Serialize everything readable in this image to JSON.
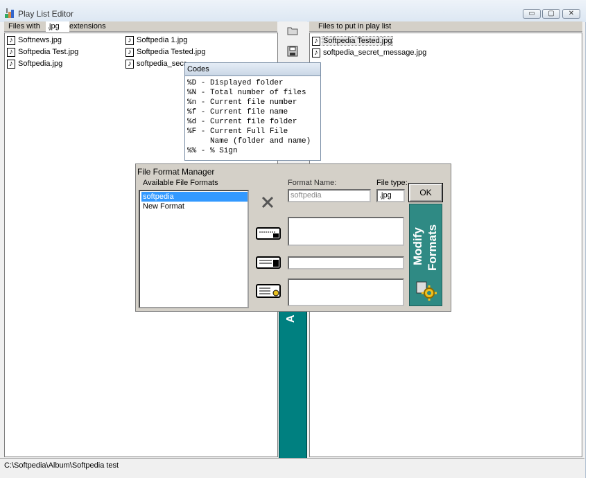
{
  "window": {
    "title": "Play List Editor",
    "minimize_label": "▭",
    "maximize_label": "▢",
    "close_label": "✕"
  },
  "left_header": {
    "prefix": "Files with",
    "extension": ".jpg",
    "suffix": "extensions"
  },
  "right_header": {
    "label": "Files to put in play list"
  },
  "left_files": [
    {
      "name": "Softnews.jpg"
    },
    {
      "name": "Softpedia Test.jpg"
    },
    {
      "name": "Softpedia.jpg"
    },
    {
      "name": "Softpedia 1.jpg"
    },
    {
      "name": "Softpedia Tested.jpg"
    },
    {
      "name": "softpedia_secr"
    }
  ],
  "right_files": [
    {
      "name": "Softpedia Tested.jpg"
    },
    {
      "name": "softpedia_secret_message.jpg"
    }
  ],
  "codes": {
    "title": "Codes",
    "lines": [
      "%D - Displayed folder",
      "%N - Total number of files",
      "%n - Current file number",
      "%f - Current file name",
      "%d - Current file folder",
      "%F - Current Full File",
      "     Name (folder and name)",
      "%% - % Sign"
    ]
  },
  "format_manager": {
    "title": "File Format Manager",
    "available_label": "Available File Formats",
    "formats": [
      "softpedia",
      "New Format"
    ],
    "format_name_label": "Format Name:",
    "format_name_value": "softpedia",
    "file_type_label": "File type:",
    "file_type_value": ".jpg",
    "ok_label": "OK",
    "panel_text_1": "Modify",
    "panel_text_2": "Formats"
  },
  "status": {
    "path": "C:\\Softpedia\\Album\\Softpedia test"
  },
  "teal_strip_text": "A",
  "colors": {
    "teal": "#008080",
    "selection": "#3399ff",
    "panel_teal": "#2f8a84"
  }
}
